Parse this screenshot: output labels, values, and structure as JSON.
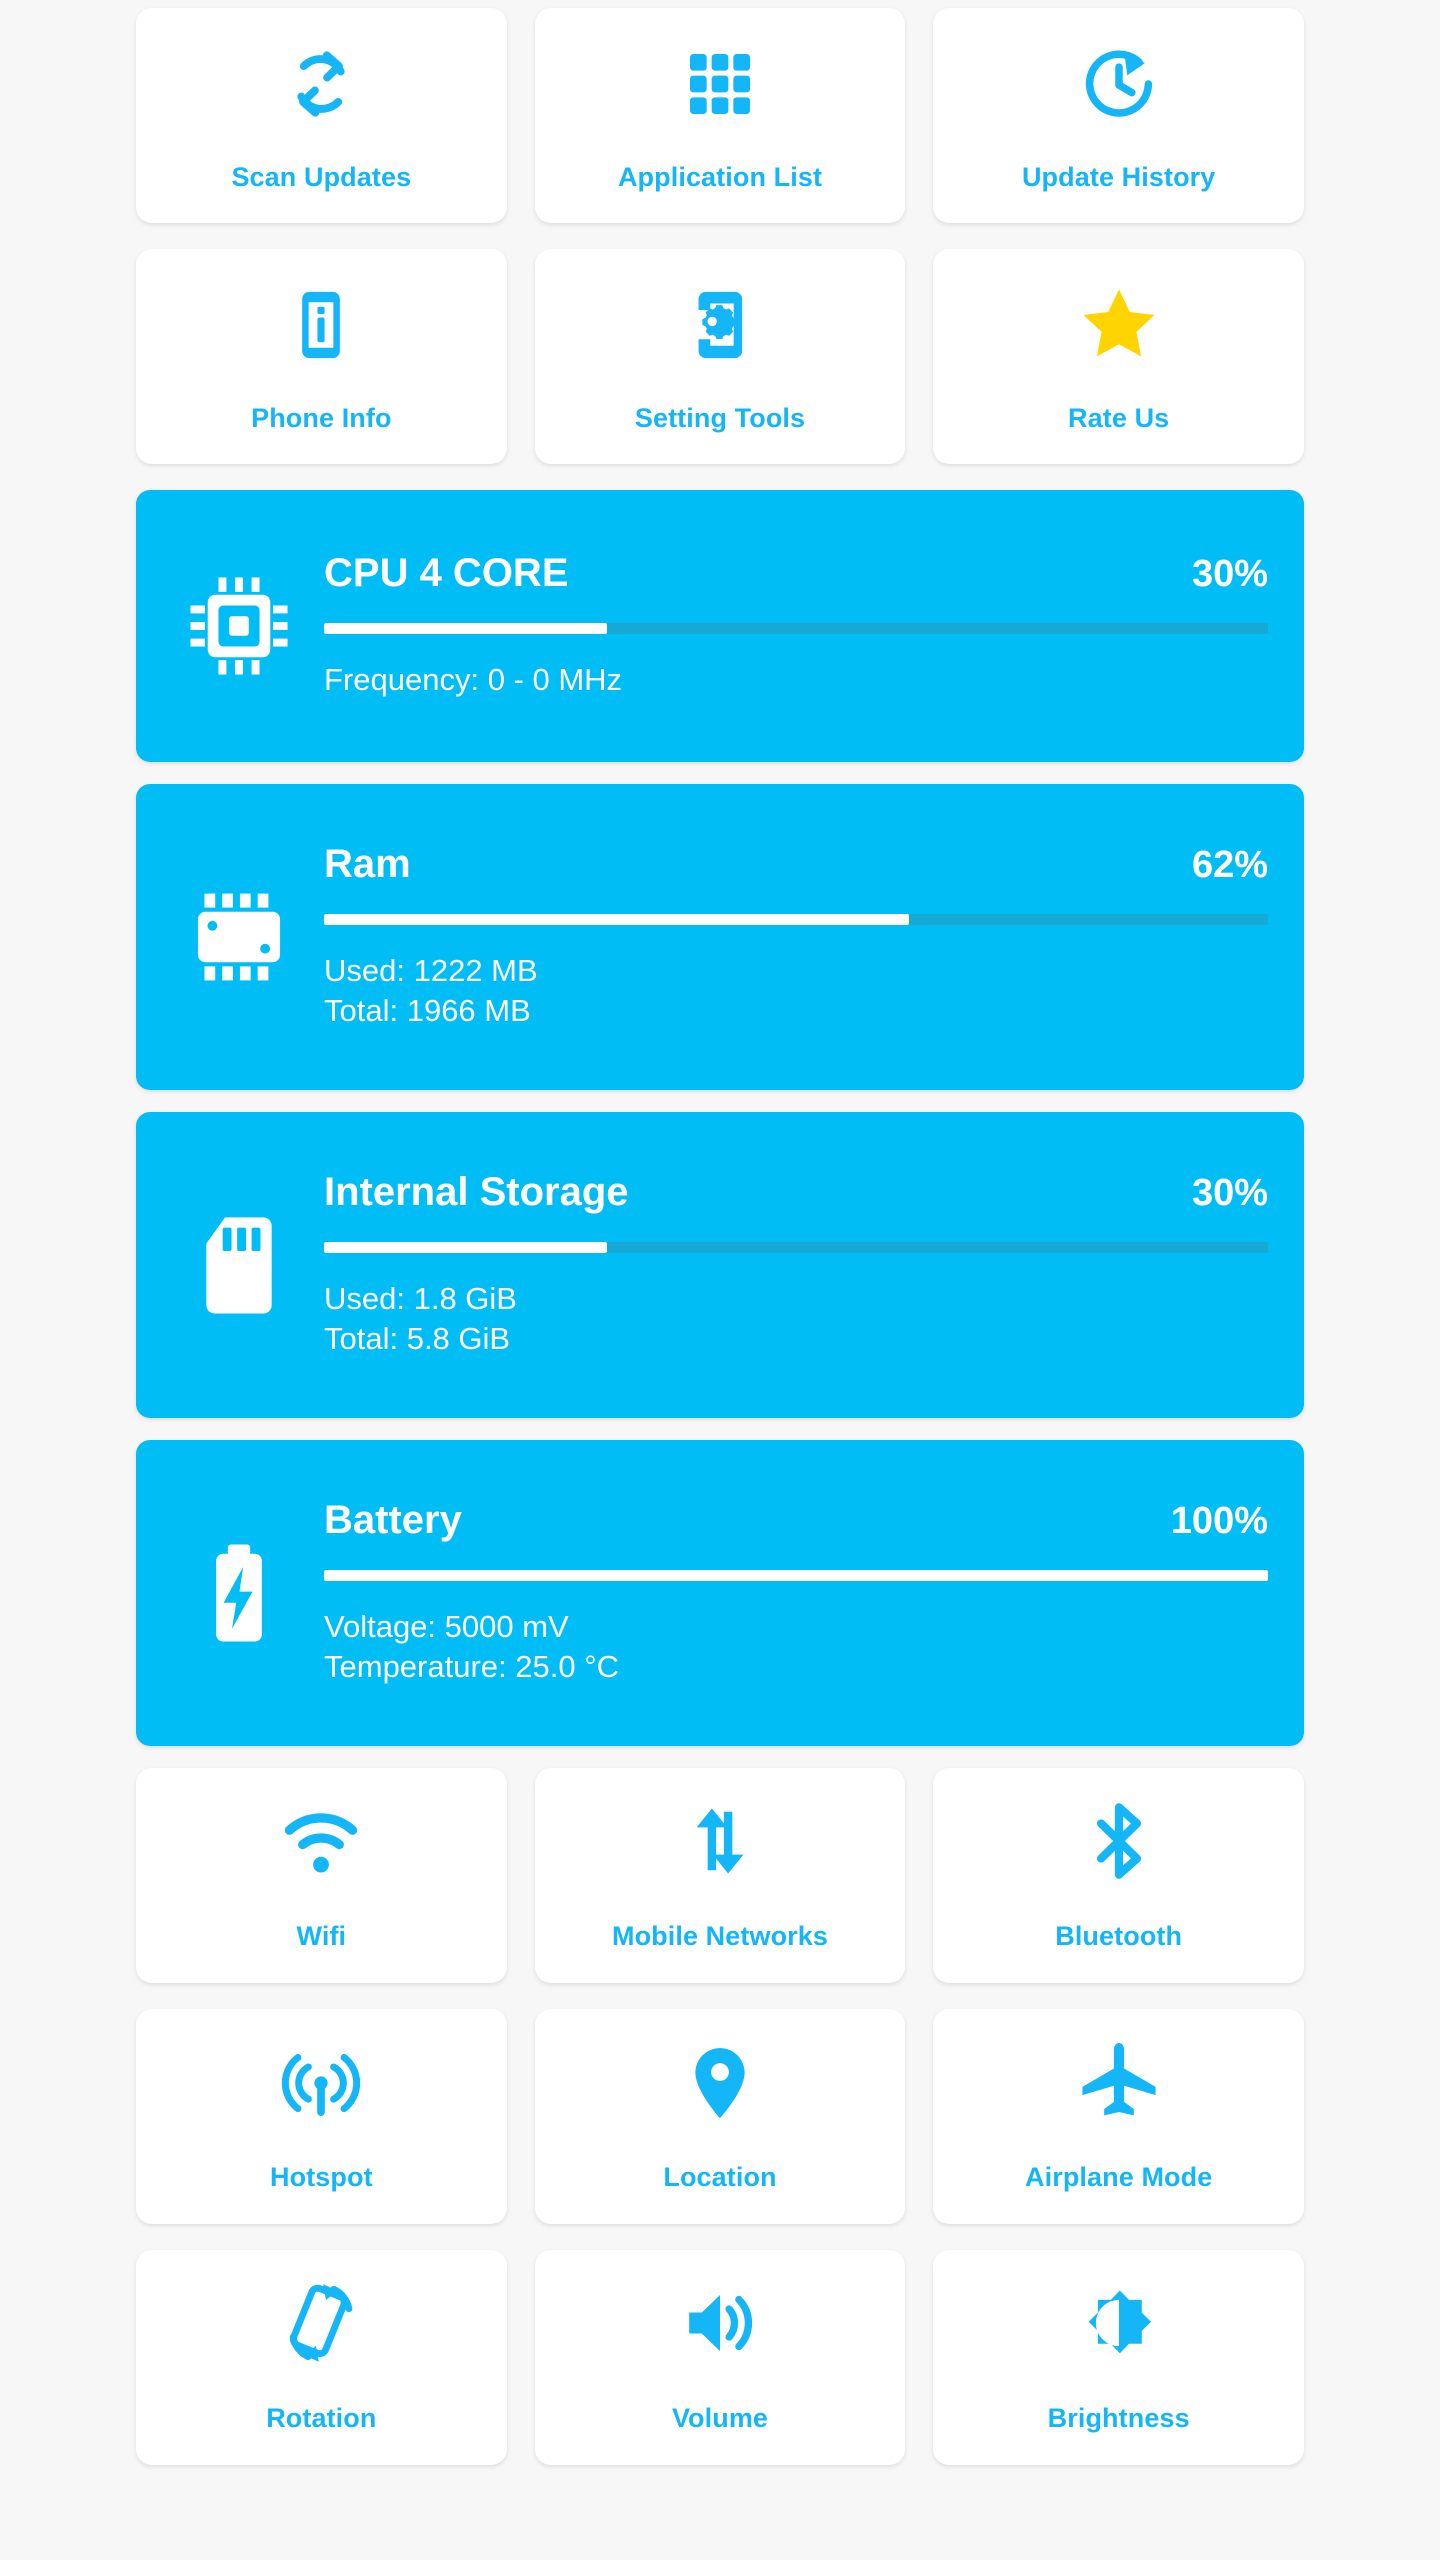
{
  "theme": {
    "accent": "#14b6f7",
    "card_blue": "#00bdf5",
    "track_blue": "#17a9d6",
    "star_yellow": "#ffd400",
    "page_bg": "#f7f7f7",
    "tile_bg": "#ffffff"
  },
  "top_tiles": [
    [
      {
        "label": "Scan Updates",
        "icon": "sync-icon"
      },
      {
        "label": "Application List",
        "icon": "apps-grid-icon"
      },
      {
        "label": "Update History",
        "icon": "history-clock-icon"
      }
    ],
    [
      {
        "label": "Phone Info",
        "icon": "phone-info-icon"
      },
      {
        "label": "Setting Tools",
        "icon": "phone-gear-icon"
      },
      {
        "label": "Rate Us",
        "icon": "star-icon"
      }
    ]
  ],
  "stats": [
    {
      "key": "cpu",
      "icon": "cpu-chip-icon",
      "title": "CPU 4 CORE",
      "percent_label": "30%",
      "percent": 30,
      "lines": [
        "Frequency: 0 - 0 MHz"
      ]
    },
    {
      "key": "ram",
      "icon": "ram-chip-icon",
      "title": "Ram",
      "percent_label": "62%",
      "percent": 62,
      "lines": [
        "Used: 1222 MB",
        "Total: 1966 MB"
      ]
    },
    {
      "key": "storage",
      "icon": "sd-card-icon",
      "title": "Internal Storage",
      "percent_label": "30%",
      "percent": 30,
      "lines": [
        "Used: 1.8 GiB",
        "Total: 5.8 GiB"
      ]
    },
    {
      "key": "battery",
      "icon": "battery-bolt-icon",
      "title": "Battery",
      "percent_label": "100%",
      "percent": 100,
      "lines": [
        "Voltage: 5000 mV",
        "Temperature: 25.0 °C"
      ]
    }
  ],
  "toggle_tiles": [
    [
      {
        "label": "Wifi",
        "icon": "wifi-icon"
      },
      {
        "label": "Mobile Networks",
        "icon": "data-transfer-icon"
      },
      {
        "label": "Bluetooth",
        "icon": "bluetooth-icon"
      }
    ],
    [
      {
        "label": "Hotspot",
        "icon": "hotspot-icon"
      },
      {
        "label": "Location",
        "icon": "location-pin-icon"
      },
      {
        "label": "Airplane Mode",
        "icon": "airplane-icon"
      }
    ],
    [
      {
        "label": "Rotation",
        "icon": "screen-rotation-icon"
      },
      {
        "label": "Volume",
        "icon": "volume-icon"
      },
      {
        "label": "Brightness",
        "icon": "brightness-icon"
      }
    ]
  ]
}
